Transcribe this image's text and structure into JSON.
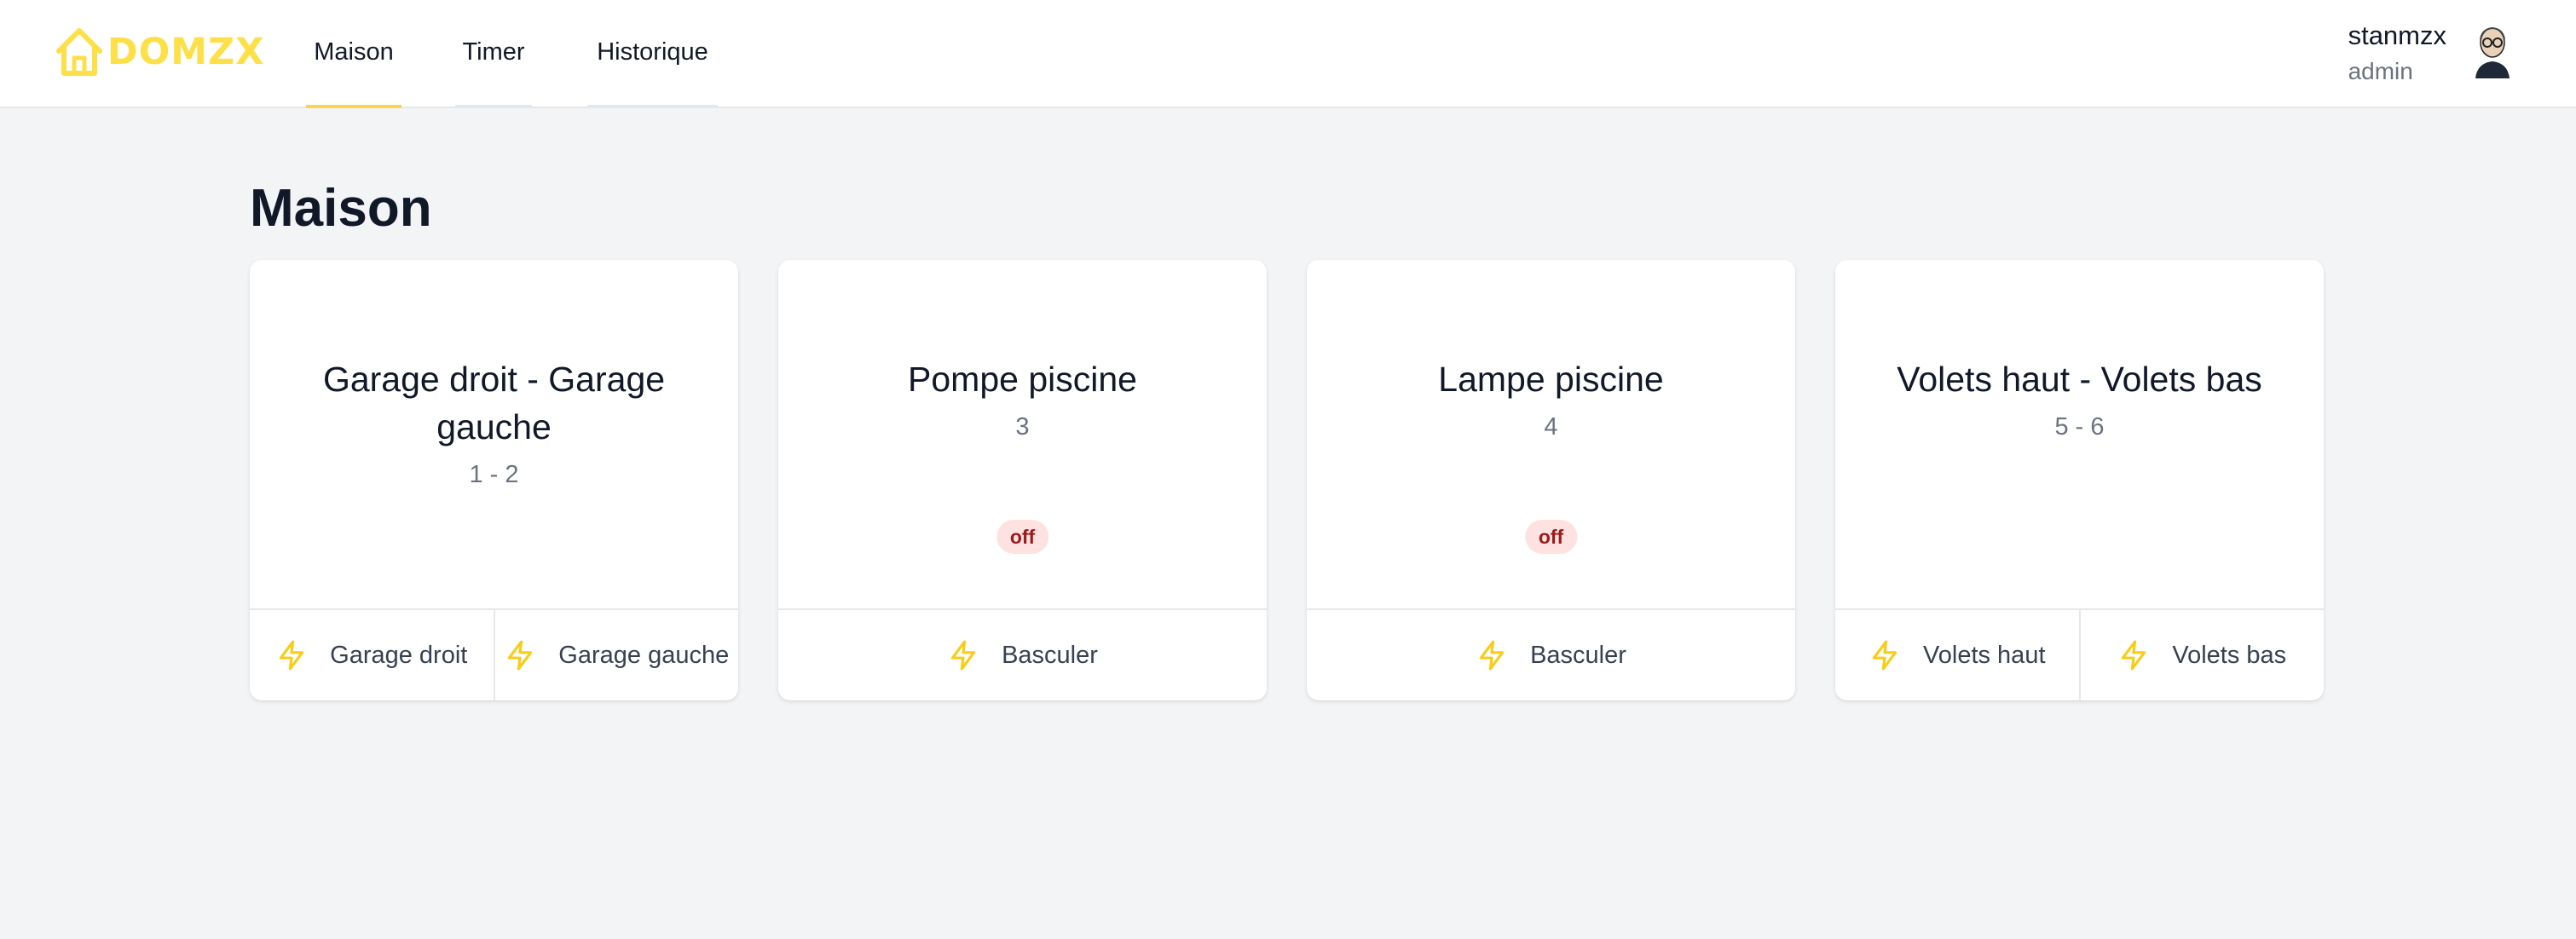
{
  "app": {
    "logo_text": "DOMZX",
    "brand_color": "#fde047"
  },
  "nav": {
    "tabs": [
      {
        "label": "Maison",
        "active": true
      },
      {
        "label": "Timer",
        "active": false
      },
      {
        "label": "Historique",
        "active": false
      }
    ]
  },
  "user": {
    "name": "stanmzx",
    "role": "admin",
    "avatar_icon": "avatar-icon"
  },
  "page": {
    "title": "Maison"
  },
  "cards": [
    {
      "title": "Garage droit - Garage gauche",
      "subtitle": "1 - 2",
      "status": null,
      "actions": [
        {
          "label": "Garage droit",
          "icon": "lightning-icon"
        },
        {
          "label": "Garage gauche",
          "icon": "lightning-icon"
        }
      ]
    },
    {
      "title": "Pompe piscine",
      "subtitle": "3",
      "status": "off",
      "actions": [
        {
          "label": "Basculer",
          "icon": "lightning-icon"
        }
      ]
    },
    {
      "title": "Lampe piscine",
      "subtitle": "4",
      "status": "off",
      "actions": [
        {
          "label": "Basculer",
          "icon": "lightning-icon"
        }
      ]
    },
    {
      "title": "Volets haut - Volets bas",
      "subtitle": "5 - 6",
      "status": null,
      "actions": [
        {
          "label": "Volets haut",
          "icon": "lightning-icon"
        },
        {
          "label": "Volets bas",
          "icon": "lightning-icon"
        }
      ]
    }
  ],
  "colors": {
    "accent": "#fcd34d",
    "icon": "#facc15",
    "status_off_bg": "#fee2e2",
    "status_off_text": "#991b1b",
    "page_bg": "#f3f4f6"
  }
}
